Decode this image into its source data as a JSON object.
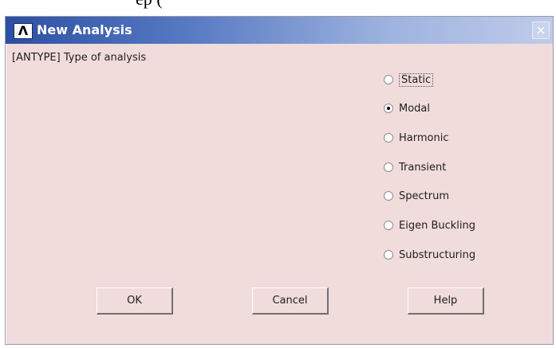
{
  "page_fragment": "ep (",
  "dialog": {
    "title": "New Analysis",
    "logo_text": "Λ",
    "close_icon": "close-icon",
    "prompt_label": "[ANTYPE]  Type of analysis",
    "options": [
      {
        "label": "Static",
        "selected": false
      },
      {
        "label": "Modal",
        "selected": true
      },
      {
        "label": "Harmonic",
        "selected": false
      },
      {
        "label": "Transient",
        "selected": false
      },
      {
        "label": "Spectrum",
        "selected": false
      },
      {
        "label": "Eigen Buckling",
        "selected": false
      },
      {
        "label": "Substructuring",
        "selected": false
      }
    ],
    "buttons": {
      "ok": "OK",
      "cancel": "Cancel",
      "help": "Help"
    }
  },
  "colors": {
    "dialog_background": "#f0dcdb",
    "titlebar_start": "#2c4fa3",
    "titlebar_end": "#bfcbea"
  }
}
